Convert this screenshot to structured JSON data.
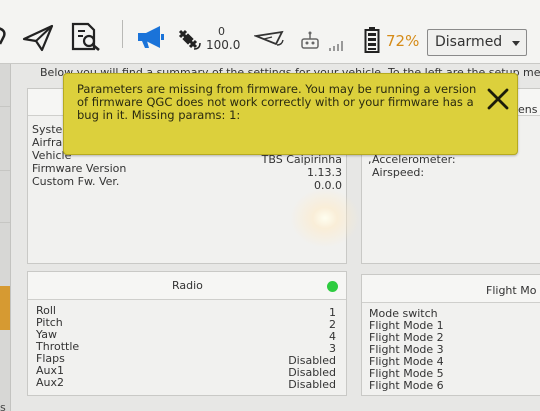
{
  "toolbar": {
    "link_count": "0",
    "gps_value": "100.0",
    "battery_percent": "72%",
    "arm_state": "Disarmed"
  },
  "summary": {
    "intro_text": "Below you will find a summary of the settings for your vehicle. To the left are the setup me",
    "sensors_header_fragment": "ens"
  },
  "alert": {
    "message": "Parameters are missing from firmware. You may be running a version of firmware QGC does not work correctly with or your firmware has a bug in it. Missing params: 1:"
  },
  "airframe_panel": {
    "labels": [
      "Syster",
      "Airfra",
      "Vehicle",
      "Firmware Version",
      "Custom Fw. Ver."
    ],
    "values": [
      "TBS Caipirinha",
      "1.13.3",
      "0.0.0"
    ]
  },
  "sensors_panel": {
    "labels": [
      "Accelerometer:",
      "Airspeed:"
    ]
  },
  "radio_panel": {
    "title": "Radio",
    "status_color": "#2ecc40",
    "rows": [
      {
        "label": "Roll",
        "value": "1"
      },
      {
        "label": "Pitch",
        "value": "2"
      },
      {
        "label": "Yaw",
        "value": "4"
      },
      {
        "label": "Throttle",
        "value": "3"
      },
      {
        "label": "Flaps",
        "value": "Disabled"
      },
      {
        "label": "Aux1",
        "value": "Disabled"
      },
      {
        "label": "Aux2",
        "value": "Disabled"
      }
    ]
  },
  "flight_modes_panel": {
    "title": "Flight Mo",
    "rows": [
      "Mode switch",
      "Flight Mode 1",
      "Flight Mode 2",
      "Flight Mode 3",
      "Flight Mode 4",
      "Flight Mode 5",
      "Flight Mode 6"
    ]
  },
  "left_strip": {
    "fragment": "s"
  },
  "colors": {
    "alert_bg": "#dcd03c",
    "accent_blue": "#1a73d9",
    "battery": "#d58b18"
  },
  "icons": [
    "back-icon",
    "send-icon",
    "plan-icon",
    "megaphone-icon",
    "satellite-icon",
    "rc-link-icon",
    "joystick-icon",
    "signal-icon",
    "battery-icon",
    "close-icon"
  ]
}
